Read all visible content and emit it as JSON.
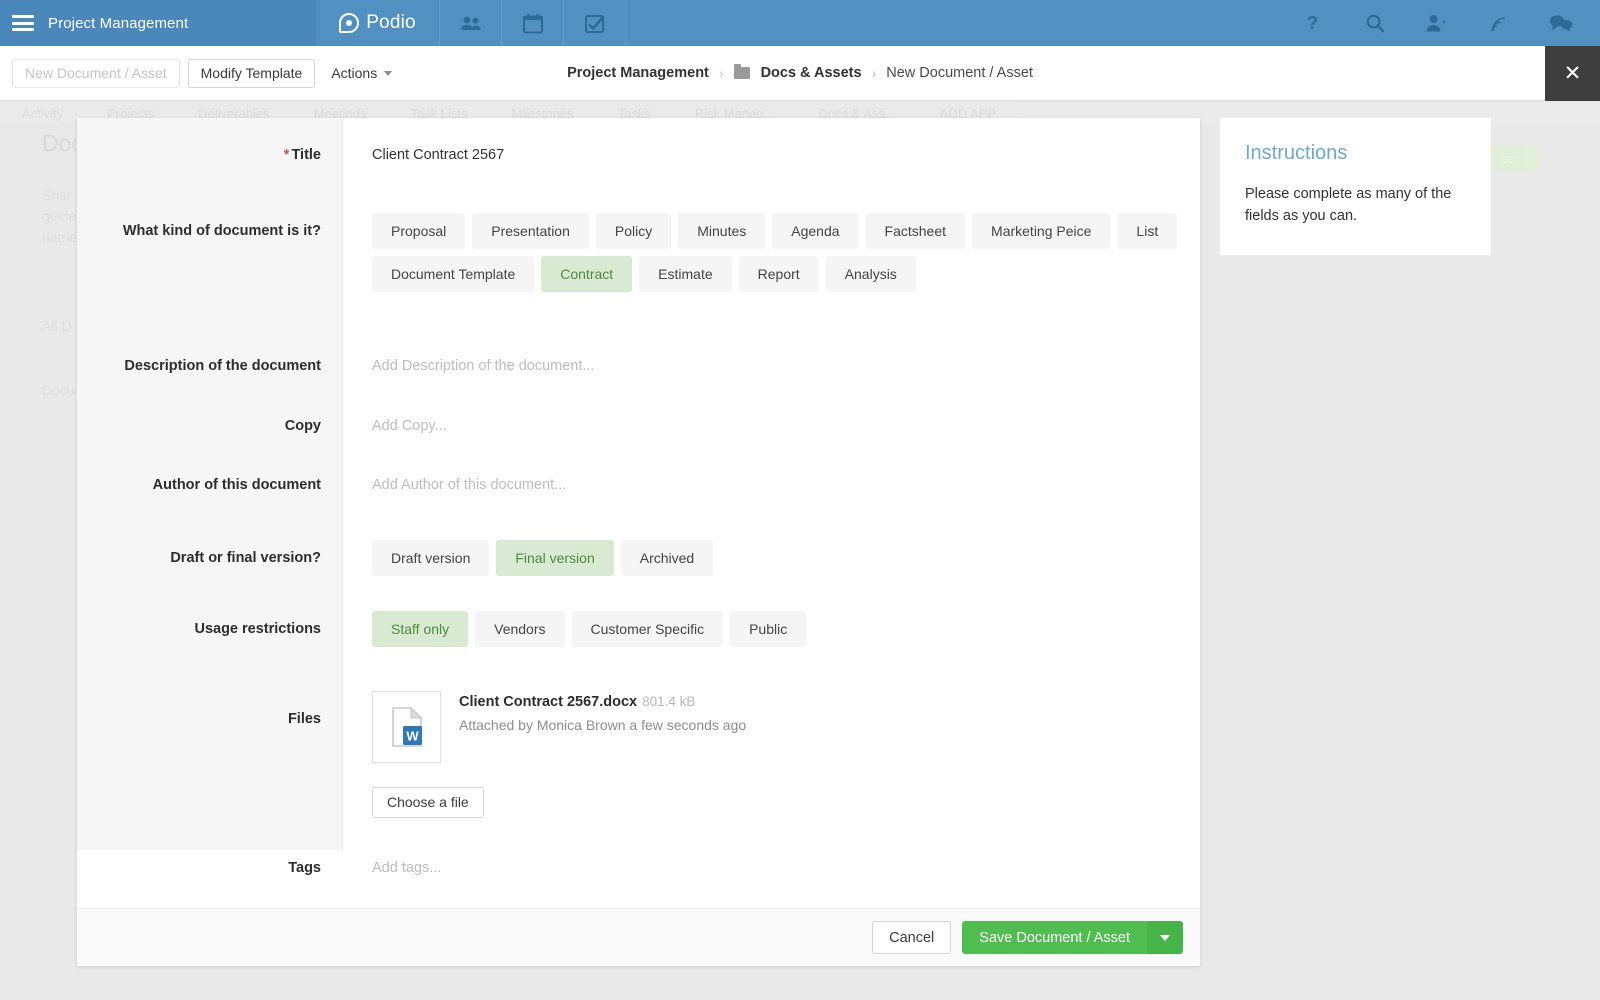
{
  "topbar": {
    "app_title": "Project Management",
    "menu_icon": "hamburger-icon",
    "brand": "Podio",
    "nav_icons": [
      "contacts-icon",
      "calendar-icon",
      "tasks-icon"
    ],
    "right_icons": [
      "help-icon",
      "search-icon",
      "profile-icon",
      "activity-icon",
      "chat-icon"
    ]
  },
  "toolbar": {
    "new_button": "New Document / Asset",
    "modify_button": "Modify Template",
    "actions_button": "Actions",
    "close_label": "✕"
  },
  "breadcrumb": {
    "workspace": "Project Management",
    "sep": "›",
    "app": "Docs & Assets",
    "current": "New Document / Asset"
  },
  "background": {
    "tabs": [
      "Activity",
      "Projects",
      "Deliverables",
      "Meetings",
      "Task Lists",
      "Milestones",
      "Tasks",
      "Risk Manag...",
      "Docs & Ass...",
      "ADD APP"
    ],
    "heading": "Doc",
    "paragraph": "Shar\nguide\nname",
    "filter": "All D",
    "section": "Docu",
    "green_button": "set"
  },
  "form": {
    "fields": [
      {
        "label": "Title",
        "required": true,
        "type": "text",
        "value": "Client Contract 2567"
      },
      {
        "label": "What kind of document is it?",
        "required": false,
        "type": "chips"
      },
      {
        "label": "Description of the document",
        "required": false,
        "type": "placeholder",
        "placeholder": "Add Description of the document..."
      },
      {
        "label": "Copy",
        "required": false,
        "type": "placeholder",
        "placeholder": "Add Copy..."
      },
      {
        "label": "Author of this document",
        "required": false,
        "type": "placeholder",
        "placeholder": "Add Author of this document..."
      },
      {
        "label": "Draft or final version?",
        "required": false,
        "type": "chips"
      },
      {
        "label": "Usage restrictions",
        "required": false,
        "type": "chips"
      },
      {
        "label": "Files",
        "required": false,
        "type": "files"
      },
      {
        "label": "Tags",
        "required": false,
        "type": "placeholder",
        "placeholder": "Add tags..."
      }
    ],
    "document_kind": {
      "options": [
        "Proposal",
        "Presentation",
        "Policy",
        "Minutes",
        "Agenda",
        "Factsheet",
        "Marketing Peice",
        "List",
        "Document Template",
        "Contract",
        "Estimate",
        "Report",
        "Analysis"
      ],
      "selected": "Contract"
    },
    "version": {
      "options": [
        "Draft version",
        "Final version",
        "Archived"
      ],
      "selected": "Final version"
    },
    "usage": {
      "options": [
        "Staff only",
        "Vendors",
        "Customer Specific",
        "Public"
      ],
      "selected": "Staff only"
    },
    "files": {
      "name": "Client Contract 2567.docx",
      "size": "801.4 kB",
      "attached": "Attached by Monica Brown a few seconds ago",
      "icon": "word-document-icon",
      "choose_button": "Choose a file"
    },
    "footer": {
      "cancel": "Cancel",
      "save": "Save Document / Asset"
    }
  },
  "instructions": {
    "title": "Instructions",
    "body": "Please complete as many of the fields as you can."
  },
  "colors": {
    "topbar": "#5191c2",
    "topbar_left": "#4a87ba",
    "selected_chip_bg": "#d9ead3",
    "selected_chip_text": "#4f8a3d",
    "save_green": "#4fbd4f",
    "instructions_title": "#6fa8cf",
    "required_star": "#d9534f"
  }
}
